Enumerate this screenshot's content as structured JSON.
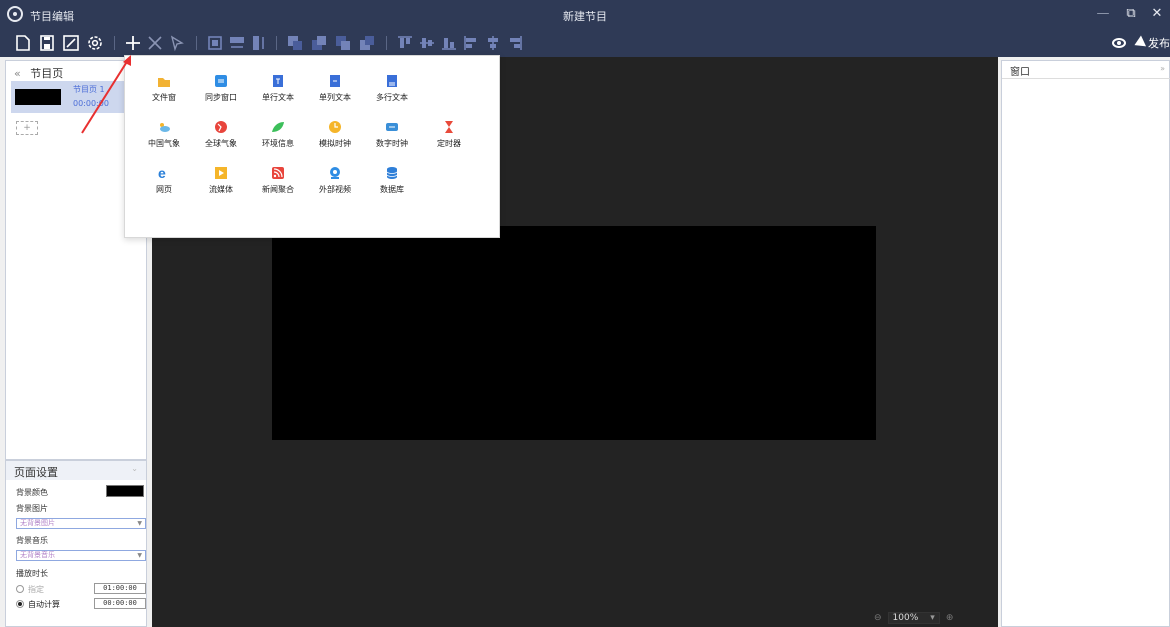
{
  "titlebar": {
    "app_title": "节目编辑",
    "doc_title": "新建节目",
    "minimize": "—",
    "restore": "⧉",
    "close": "✕"
  },
  "toolbar": {
    "publish_label": "发布"
  },
  "left_panel": {
    "header": "节目页",
    "collapse": "«",
    "pages": [
      {
        "name": "节目页 1",
        "duration": "00:00:00"
      }
    ],
    "add_label": "+"
  },
  "page_settings": {
    "header": "页面设置",
    "bg_color_label": "背景颜色",
    "bg_image_label": "背景图片",
    "bg_image_value": "无背景图片",
    "bg_music_label": "背景音乐",
    "bg_music_value": "无背景音乐",
    "duration_label": "播放时长",
    "option_specified": "指定",
    "option_auto": "自动计算",
    "specified_time": "01:00:00",
    "auto_time": "00:00:00"
  },
  "right_panel": {
    "header": "窗口",
    "expand": "»"
  },
  "canvas": {
    "zoom": "100%"
  },
  "add_menu": [
    {
      "label": "文件窗",
      "icon": "folder-icon",
      "color": "#f2b233"
    },
    {
      "label": "同步窗口",
      "icon": "sync-window-icon",
      "color": "#2f8de4"
    },
    {
      "label": "单行文本",
      "icon": "single-line-text-icon",
      "color": "#3a6fd8"
    },
    {
      "label": "单列文本",
      "icon": "single-column-text-icon",
      "color": "#3a6fd8"
    },
    {
      "label": "多行文本",
      "icon": "multi-line-text-icon",
      "color": "#3a6fd8"
    },
    {
      "label": "中国气象",
      "icon": "china-weather-icon",
      "color": "#6bb8e8"
    },
    {
      "label": "全球气象",
      "icon": "global-weather-icon",
      "color": "#e8453c"
    },
    {
      "label": "环境信息",
      "icon": "environment-icon",
      "color": "#3cbf5a"
    },
    {
      "label": "模拟时钟",
      "icon": "analog-clock-icon",
      "color": "#f5b52a"
    },
    {
      "label": "数字时钟",
      "icon": "digital-clock-icon",
      "color": "#3a8fd8"
    },
    {
      "label": "定时器",
      "icon": "timer-icon",
      "color": "#e84a3a"
    },
    {
      "label": "网页",
      "icon": "web-page-icon",
      "color": "#2a7fd8"
    },
    {
      "label": "流媒体",
      "icon": "streaming-media-icon",
      "color": "#f5b52a"
    },
    {
      "label": "新闻聚合",
      "icon": "news-feed-icon",
      "color": "#e8453c"
    },
    {
      "label": "外部视频",
      "icon": "external-video-icon",
      "color": "#2f8de4"
    },
    {
      "label": "数据库",
      "icon": "database-icon",
      "color": "#2f7fd8"
    }
  ]
}
